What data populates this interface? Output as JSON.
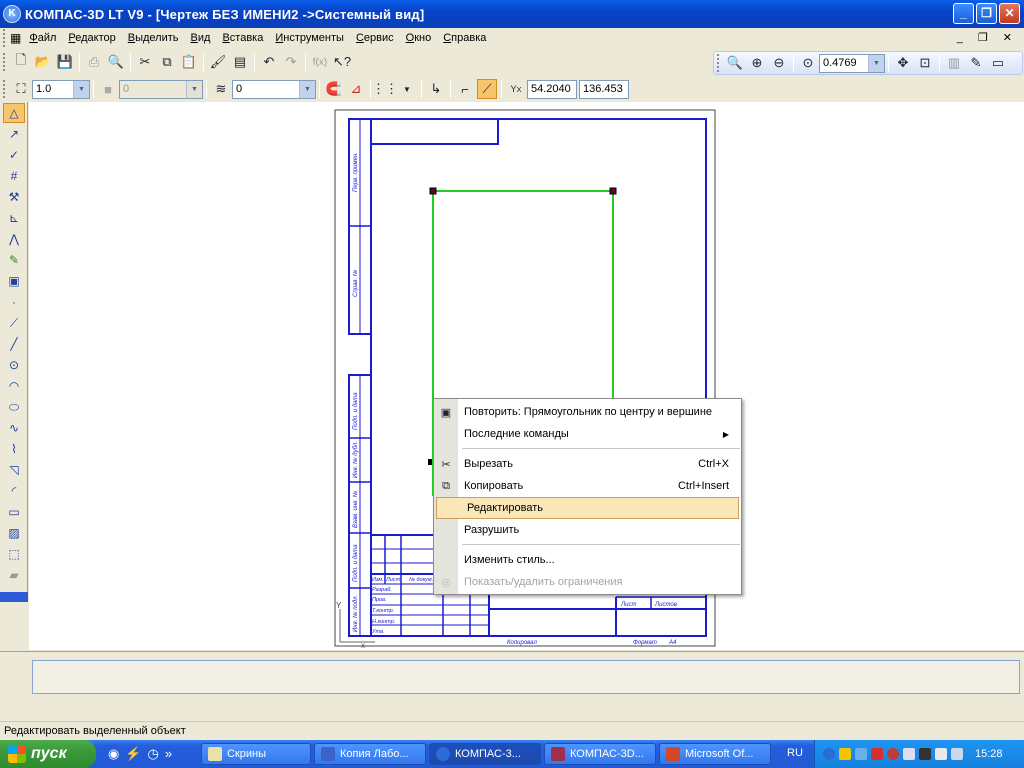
{
  "window": {
    "title": "КОМПАС-3D LT V9 - [Чертеж БЕЗ ИМЕНИ2 ->Системный вид]"
  },
  "menu": [
    "Файл",
    "Редактор",
    "Выделить",
    "Вид",
    "Вставка",
    "Инструменты",
    "Сервис",
    "Окно",
    "Справка"
  ],
  "toolbar": {
    "zoom_value": "0.4769",
    "line_scale": "1.0",
    "layer_disabled_value": "0",
    "layer_value": "0",
    "coord_x": "54.2040",
    "coord_y": "136.453"
  },
  "drawing": {
    "stamp_labels": {
      "perv_primen": "Перв. примен.",
      "sprav_no": "Справ. №",
      "podp_data1": "Подп. и дата",
      "inv_dubl": "Инв. № дубл.",
      "vzam_inv": "Взам. инв. №",
      "podp_data2": "Подп. и дата",
      "inv_podl": "Инв. № подл.",
      "izm": "Изм.",
      "list_col": "Лист",
      "no_dokum": "№ докум.",
      "razrab": "Разраб.",
      "prov": "Пров.",
      "t_kontr": "Т.контр.",
      "n_kontr": "Н.контр.",
      "utv": "Утв.",
      "list": "Лист",
      "listov": "Листов",
      "kopiroval": "Копировал",
      "format": "Формат",
      "format_value": "A4"
    },
    "origin_y": "Y",
    "origin_x": "X"
  },
  "context_menu": {
    "items": [
      {
        "label": "Повторить: Прямоугольник по центру и вершине",
        "icon": "rect-center-icon"
      },
      {
        "label": "Последние команды",
        "submenu": true
      },
      {
        "label": "Вырезать",
        "shortcut": "Ctrl+X",
        "icon": "scissors-icon"
      },
      {
        "label": "Копировать",
        "shortcut": "Ctrl+Insert",
        "icon": "copy-icon"
      },
      {
        "label": "Редактировать",
        "highlighted": true
      },
      {
        "label": "Разрушить"
      },
      {
        "label": "Изменить стиль..."
      },
      {
        "label": "Показать/удалить ограничения",
        "disabled": true,
        "icon": "constraints-icon"
      }
    ]
  },
  "status": {
    "text": "Редактировать выделенный объект"
  },
  "taskbar": {
    "start": "пуск",
    "tasks": [
      "Скрины",
      "Копия Лабо...",
      "КОМПАС-3...",
      "КОМПАС-3D...",
      "Microsoft Of..."
    ],
    "lang": "RU",
    "clock": "15:28"
  },
  "colors": {
    "frame": "#1a1ad0",
    "selection": "#22cc22",
    "highlight": "#fbe6b8"
  }
}
